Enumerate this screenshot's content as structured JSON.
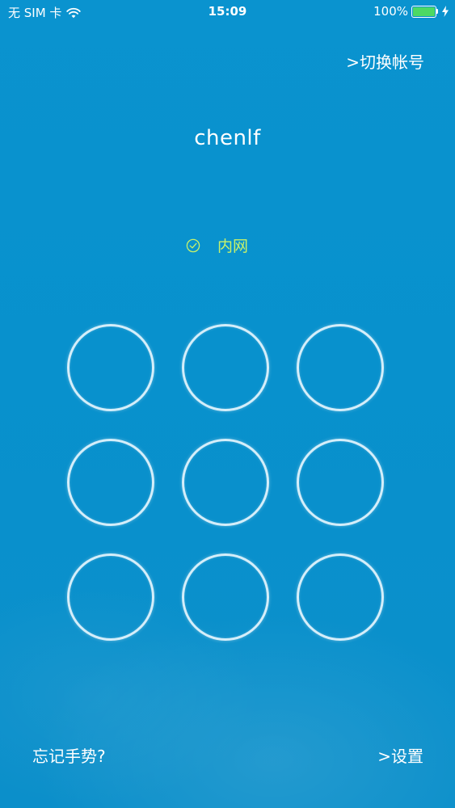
{
  "status_bar": {
    "carrier": "无 SIM 卡",
    "time": "15:09",
    "battery": "100%",
    "battery_color": "#4cd964"
  },
  "header": {
    "switch_account": ">切换帐号"
  },
  "user": {
    "name": "chenlf"
  },
  "network": {
    "label": "内网",
    "checked": true,
    "label_color": "#c8f26a"
  },
  "gesture_grid": {
    "rows": 3,
    "cols": 3
  },
  "footer": {
    "forgot": "忘记手势?",
    "settings": ">设置"
  },
  "colors": {
    "background": "#0891cd"
  }
}
